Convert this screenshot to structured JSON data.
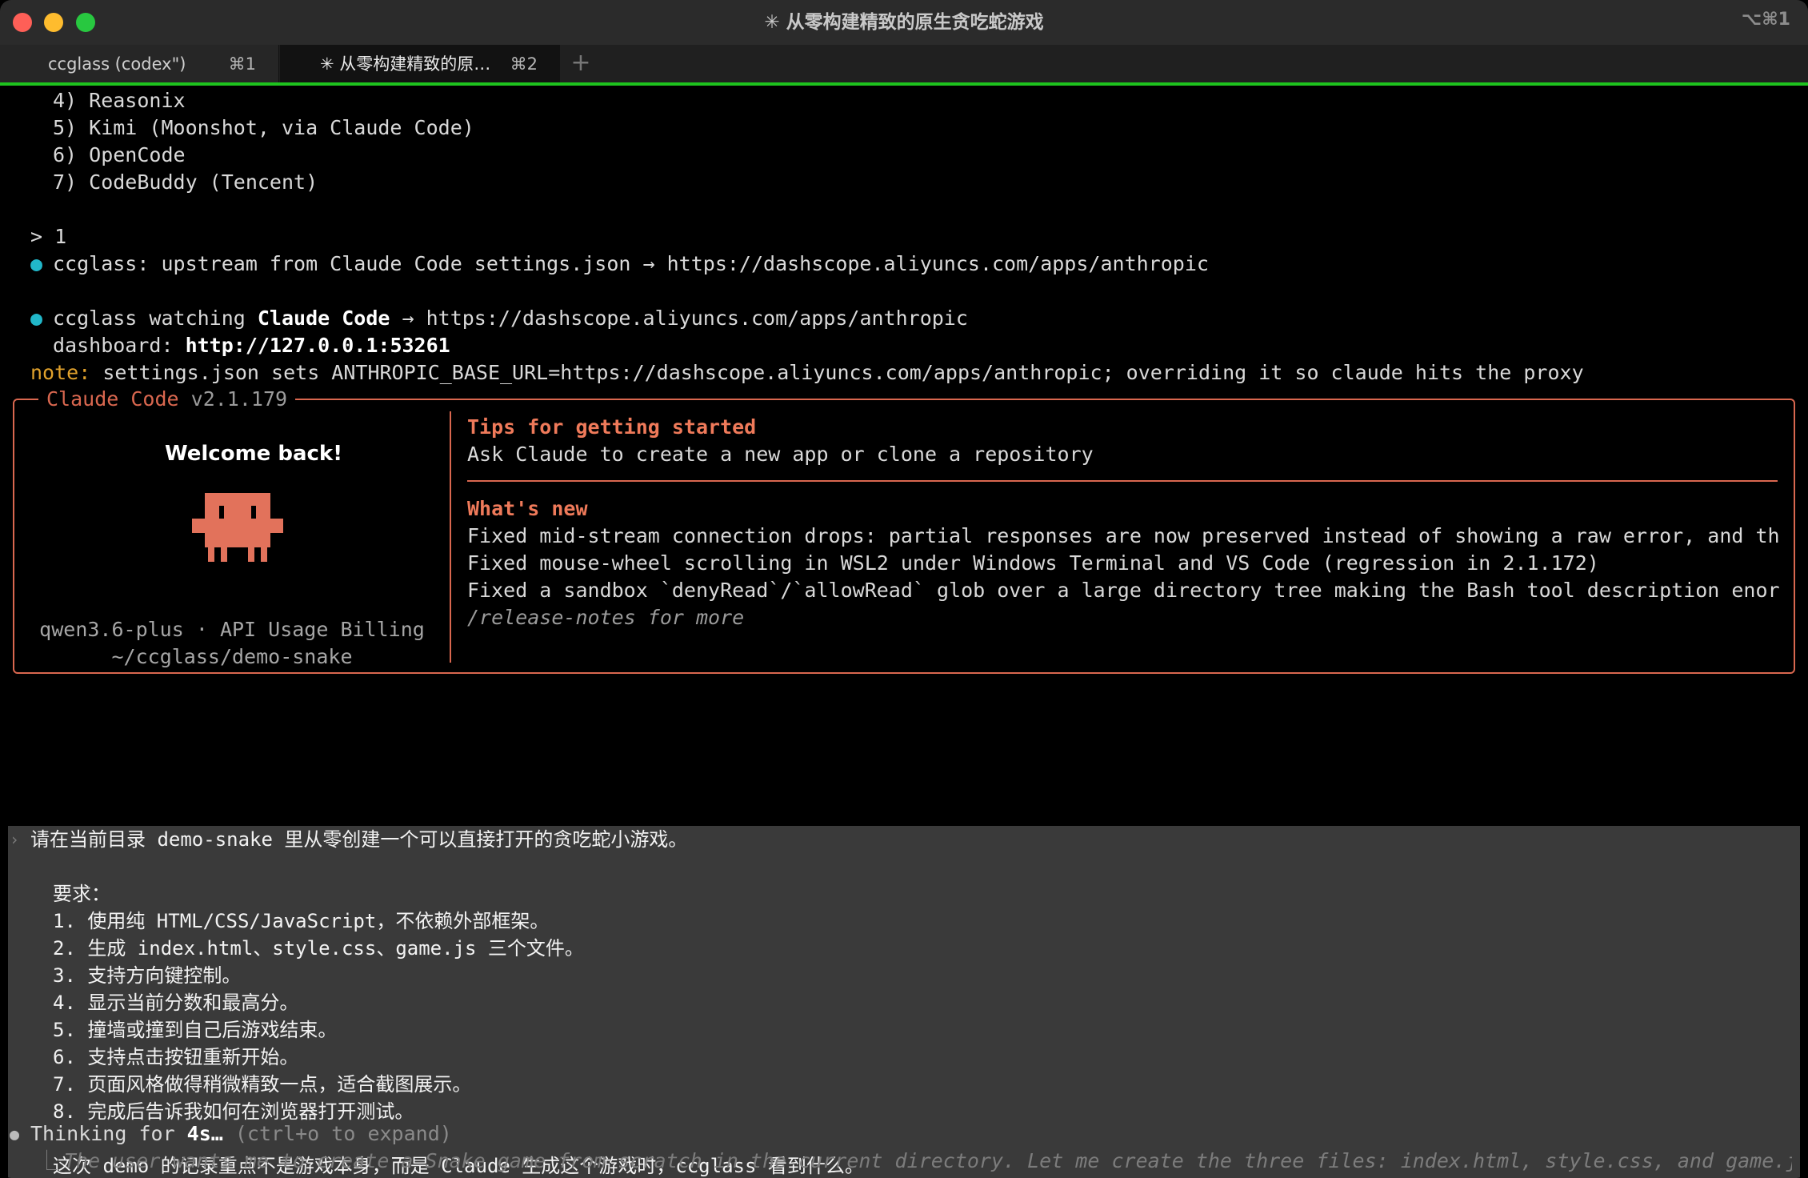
{
  "window": {
    "title": "✳ 从零构建精致的原生贪吃蛇游戏",
    "shortcut": "⌥⌘1",
    "tabs": [
      {
        "label": "ccglass (codex\")",
        "shortcut": "⌘1"
      },
      {
        "label": "✳ 从零构建精致的原…",
        "shortcut": "⌘2"
      }
    ],
    "new_tab": "+"
  },
  "terminal": {
    "menu_items": [
      "4) Reasonix",
      "5) Kimi (Moonshot, via Claude Code)",
      "6) OpenCode",
      "7) CodeBuddy (Tencent)"
    ],
    "input_line": "> 1",
    "upstream_prefix": "ccglass: upstream from Claude Code settings.json → https://dashscope.aliyuncs.com/apps/anthropic",
    "watch_prefix": "ccglass watching ",
    "watch_app": "Claude Code",
    "watch_suffix": " → https://dashscope.aliyuncs.com/apps/anthropic",
    "dashboard_label": "dashboard: ",
    "dashboard_url": "http://127.0.0.1:53261",
    "note_label": "note:",
    "note_text": " settings.json sets ANTHROPIC_BASE_URL=https://dashscope.aliyuncs.com/apps/anthropic; overriding it so claude hits the proxy"
  },
  "welcome_box": {
    "title": "Claude Code",
    "version": "v2.1.179",
    "welcome": "Welcome back!",
    "model_line": "qwen3.6-plus · API Usage Billing",
    "path": "~/ccglass/demo-snake",
    "tips_heading": "Tips for getting started",
    "tips_text": "Ask Claude to create a new app or clone a repository",
    "whats_new_heading": "What's new",
    "whats_new": [
      "Fixed mid-stream connection drops: partial responses are now preserved instead of showing a raw error, and the spinn…",
      "Fixed mouse-wheel scrolling in WSL2 under Windows Terminal and VS Code (regression in 2.1.172)",
      "Fixed a sandbox `denyRead`/`allowRead` glob over a large directory tree making the Bash tool description enormous an…"
    ],
    "release_notes": "/release-notes for more"
  },
  "prompt": {
    "first_line": "请在当前目录 demo-snake 里从零创建一个可以直接打开的贪吃蛇小游戏。",
    "req_label": "要求：",
    "requirements": [
      "1. 使用纯 HTML/CSS/JavaScript，不依赖外部框架。",
      "2. 生成 index.html、style.css、game.js 三个文件。",
      "3. 支持方向键控制。",
      "4. 显示当前分数和最高分。",
      "5. 撞墙或撞到自己后游戏结束。",
      "6. 支持点击按钮重新开始。",
      "7. 页面风格做得稍微精致一点，适合截图展示。",
      "8. 完成后告诉我如何在浏览器打开测试。"
    ],
    "closing": "这次 demo 的记录重点不是游戏本身，而是 Claude 生成这个游戏时，ccglass 看到什么。"
  },
  "thinking": {
    "label": "Thinking for ",
    "duration": "4s…",
    "hint": " (ctrl+o to expand)",
    "text": "The user wants me to create a Snake game from scratch in the current directory. Let me create the three files: index.html, style.css, and game.js. This is"
  },
  "colors": {
    "accent_orange": "#d9674f",
    "tab_active_line": "#1ec31e",
    "bullet_cyan": "#21b7c9",
    "note_yellow": "#e0a12c"
  }
}
